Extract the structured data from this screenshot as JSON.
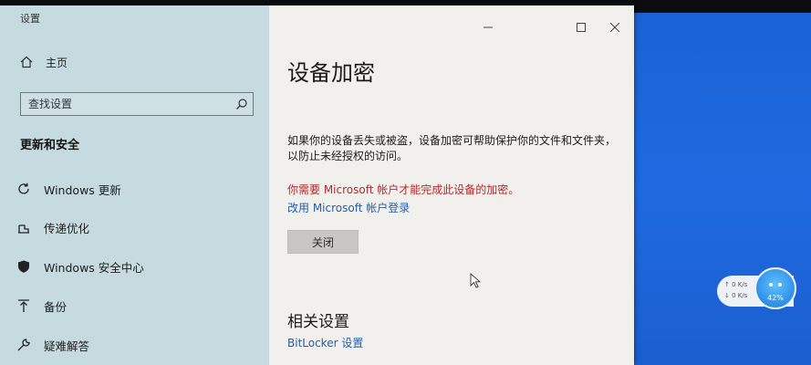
{
  "window": {
    "title": "设置"
  },
  "sidebar": {
    "home_label": "主页",
    "search_placeholder": "查找设置",
    "section_title": "更新和安全",
    "items": [
      {
        "label": "Windows 更新",
        "icon": "refresh-icon"
      },
      {
        "label": "传递优化",
        "icon": "delivery-optimization-icon"
      },
      {
        "label": "Windows 安全中心",
        "icon": "shield-icon"
      },
      {
        "label": "备份",
        "icon": "backup-arrow-icon"
      },
      {
        "label": "疑难解答",
        "icon": "wrench-icon"
      }
    ]
  },
  "main": {
    "title": "设备加密",
    "description": "如果你的设备丢失或被盗，设备加密可帮助保护你的文件和文件夹，以防止未经授权的访问。",
    "warning": "你需要 Microsoft 帐户才能完成此设备的加密。",
    "change_account_link": "改用 Microsoft 帐户登录",
    "close_button": "关闭",
    "related_title": "相关设置",
    "bitlocker_link": "BitLocker 设置"
  },
  "net_widget": {
    "upload": "0  K/s",
    "download": "0  K/s",
    "percent": "42%"
  },
  "colors": {
    "sidebar_bg": "#c6dbe0",
    "main_bg": "#f2f0ec",
    "link": "#1f5fb0",
    "warning": "#b0282c",
    "desktop": "#1f6ae0"
  }
}
